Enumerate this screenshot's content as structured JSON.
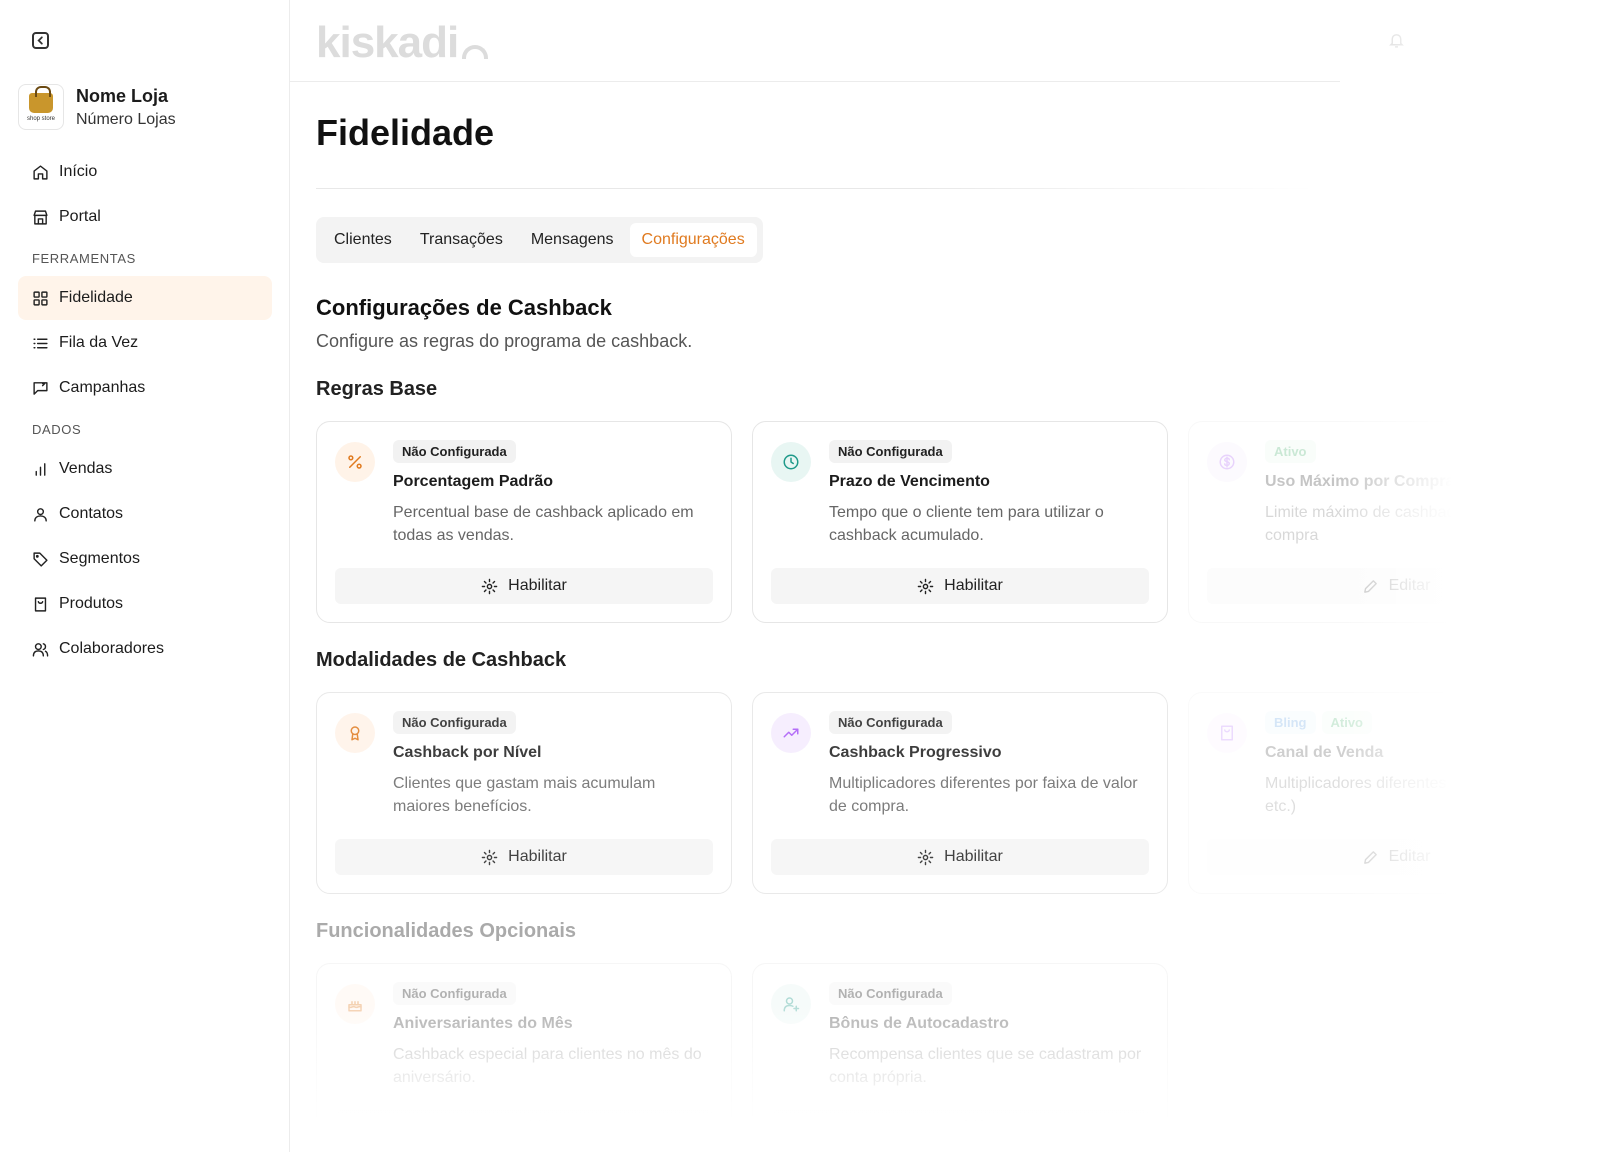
{
  "sidebar": {
    "store_name": "Nome Loja",
    "store_sub": "Número Lojas",
    "logo_text": "shop store",
    "nav": [
      {
        "label": "Início"
      },
      {
        "label": "Portal"
      }
    ],
    "section_tools": "FERRAMENTAS",
    "tools": [
      {
        "label": "Fidelidade",
        "active": true
      },
      {
        "label": "Fila da Vez"
      },
      {
        "label": "Campanhas"
      }
    ],
    "section_data": "DADOS",
    "data_items": [
      {
        "label": "Vendas"
      },
      {
        "label": "Contatos"
      },
      {
        "label": "Segmentos"
      },
      {
        "label": "Produtos"
      },
      {
        "label": "Colaboradores"
      }
    ]
  },
  "header": {
    "brand": "kiskadi"
  },
  "page": {
    "title": "Fidelidade",
    "tabs": [
      "Clientes",
      "Transações",
      "Mensagens",
      "Configurações"
    ],
    "active_tab": "Configurações",
    "section_title": "Configurações de Cashback",
    "section_desc": "Configure as regras do programa de cashback."
  },
  "groups": [
    {
      "title": "Regras Base",
      "cards": [
        {
          "badges": [
            "Não Configurada"
          ],
          "title": "Porcentagem Padrão",
          "desc": "Percentual base de cashback aplicado em todas as vendas.",
          "button": "Habilitar",
          "icon": "percent-icon",
          "accent": "#e07a1f"
        },
        {
          "badges": [
            "Não Configurada"
          ],
          "title": "Prazo de Vencimento",
          "desc": "Tempo que o cliente tem para utilizar o cashback acumulado.",
          "button": "Habilitar",
          "icon": "clock-icon",
          "accent": "#1f9a8a"
        },
        {
          "badges": [
            "Ativo"
          ],
          "title": "Uso Máximo por Compra",
          "desc": "Limite máximo de cashback usado em uma compra",
          "button": "Editar",
          "icon": "dollar-icon",
          "accent": "#a855f7"
        }
      ]
    },
    {
      "title": "Modalidades de Cashback",
      "cards": [
        {
          "badges": [
            "Não Configurada"
          ],
          "title": "Cashback por Nível",
          "desc": "Clientes que gastam mais acumulam maiores benefícios.",
          "button": "Habilitar",
          "icon": "award-icon",
          "accent": "#e07a1f"
        },
        {
          "badges": [
            "Não Configurada"
          ],
          "title": "Cashback Progressivo",
          "desc": "Multiplicadores diferentes por faixa de valor de compra.",
          "button": "Habilitar",
          "icon": "trending-up-icon",
          "accent": "#a855f7"
        },
        {
          "badges": [
            "Bling",
            "Ativo"
          ],
          "title": "Canal de Venda",
          "desc": "Multiplicadores diferentes (loja física, site, etc.)",
          "button": "Editar",
          "icon": "shopping-bag-icon",
          "accent": "#a855f7"
        }
      ]
    },
    {
      "title": "Funcionalidades Opcionais",
      "cards": [
        {
          "badges": [
            "Não Configurada"
          ],
          "title": "Aniversariantes do Mês",
          "desc": "Cashback especial para clientes no mês do aniversário.",
          "button": "Habilitar",
          "icon": "cake-icon",
          "accent": "#e07a1f"
        },
        {
          "badges": [
            "Não Configurada"
          ],
          "title": "Bônus de Autocadastro",
          "desc": "Recompensa clientes que se cadastram por conta própria.",
          "button": "Habilitar",
          "icon": "user-plus-icon",
          "accent": "#1f9a8a"
        }
      ]
    }
  ]
}
